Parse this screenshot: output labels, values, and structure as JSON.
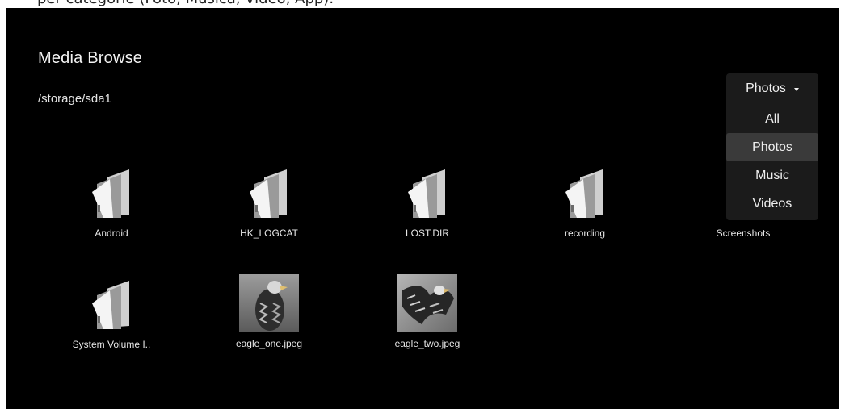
{
  "caption": "per categorie (Foto, Musica, Video, App).",
  "app": {
    "title": "Media Browse",
    "path": "/storage/sda1"
  },
  "files": [
    {
      "name": "Android",
      "type": "folder"
    },
    {
      "name": "HK_LOGCAT",
      "type": "folder"
    },
    {
      "name": "LOST.DIR",
      "type": "folder"
    },
    {
      "name": "recording",
      "type": "folder"
    },
    {
      "name": "Screenshots",
      "type": "folder"
    },
    {
      "name": "System Volume I..",
      "type": "folder"
    },
    {
      "name": "eagle_one.jpeg",
      "type": "image"
    },
    {
      "name": "eagle_two.jpeg",
      "type": "image"
    }
  ],
  "filter": {
    "selected": "Photos",
    "options": [
      "All",
      "Photos",
      "Music",
      "Videos"
    ],
    "active_option": "Photos"
  },
  "icons": {
    "folder": "folder-icon",
    "caret": "caret-down-icon"
  },
  "colors": {
    "background": "#000000",
    "dropdown_bg": "#1b1b1b",
    "dropdown_active": "#3a3a3a",
    "text": "#ffffff"
  }
}
